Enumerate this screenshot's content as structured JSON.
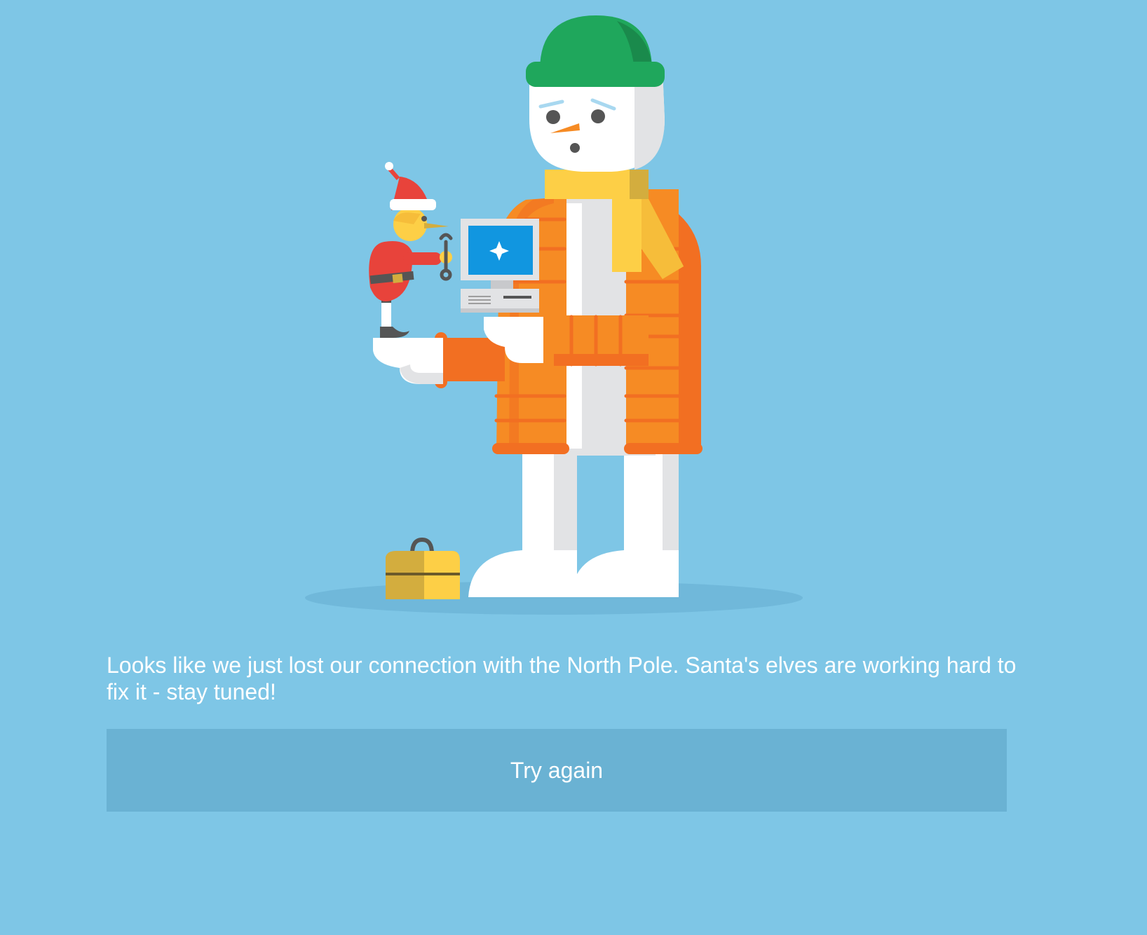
{
  "error": {
    "message": "Looks like we just lost our connection with the North Pole. Santa's elves are working hard to fix it - stay tuned!",
    "retry_label": "Try again"
  },
  "illustration": {
    "subject": "snowman-holding-computer-with-elf-repairing",
    "colors": {
      "background": "#7ec6e6",
      "hat": "#1fa75c",
      "scarf": "#fdcf46",
      "coat": "#f68b24",
      "screen": "#1196e0",
      "elf_suit": "#e8433b",
      "toolbox": "#fdcf46"
    }
  }
}
